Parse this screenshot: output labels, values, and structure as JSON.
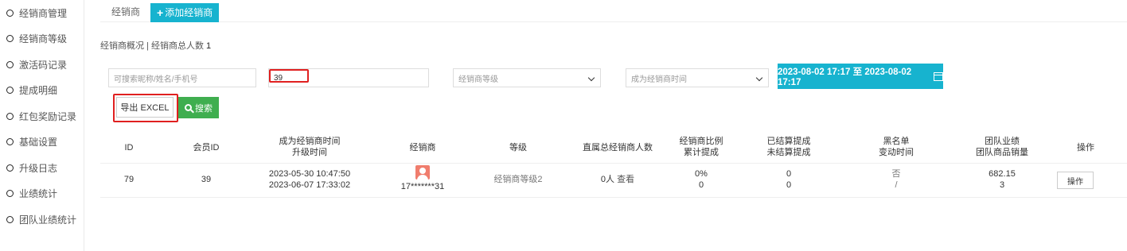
{
  "sidebar": {
    "items": [
      {
        "label": "经销商管理"
      },
      {
        "label": "经销商等级"
      },
      {
        "label": "激活码记录"
      },
      {
        "label": "提成明细"
      },
      {
        "label": "红包奖励记录"
      },
      {
        "label": "基础设置"
      },
      {
        "label": "升级日志"
      },
      {
        "label": "业绩统计"
      },
      {
        "label": "团队业绩统计"
      }
    ]
  },
  "tabs": {
    "distributor": "经销商",
    "add_distributor": "添加经销商"
  },
  "summary": {
    "label": "经销商概况 | 经销商总人数",
    "count": "1"
  },
  "filters": {
    "search_placeholder": "可搜索昵称/姓名/手机号",
    "member_id_value": "39",
    "level_select": "经销商等级",
    "time_select": "成为经销商时间",
    "date_range": "2023-08-02 17:17 至 2023-08-02 17:17"
  },
  "actions": {
    "export": "导出 EXCEL",
    "search": "搜索"
  },
  "table": {
    "headers": {
      "id": "ID",
      "member_id": "会员ID",
      "time_line1": "成为经销商时间",
      "time_line2": "升级时间",
      "distributor": "经销商",
      "level": "等级",
      "direct_count": "直属总经销商人数",
      "ratio_line1": "经销商比例",
      "ratio_line2": "累计提成",
      "settled_line1": "已结算提成",
      "settled_line2": "未结算提成",
      "blacklist_line1": "黑名单",
      "blacklist_line2": "变动时间",
      "team_line1": "团队业绩",
      "team_line2": "团队商品销量",
      "operation": "操作"
    },
    "rows": [
      {
        "id": "79",
        "member_id": "39",
        "became_time": "2023-05-30 10:47:50",
        "upgrade_time": "2023-06-07 17:33:02",
        "distributor_name": "17*******31",
        "level": "经销商等级2",
        "direct_count": "0人",
        "view_link": "查看",
        "ratio": "0%",
        "accumulated": "0",
        "settled": "0",
        "unsettled": "0",
        "blacklist": "否",
        "blacklist_time": "/",
        "team_performance": "682.15",
        "team_sales": "3",
        "operation_button": "操作"
      }
    ]
  },
  "colors": {
    "accent": "#17b3cf",
    "search_green": "#3fae4f",
    "highlight_red": "#e02020",
    "avatar": "#f07d6d"
  }
}
